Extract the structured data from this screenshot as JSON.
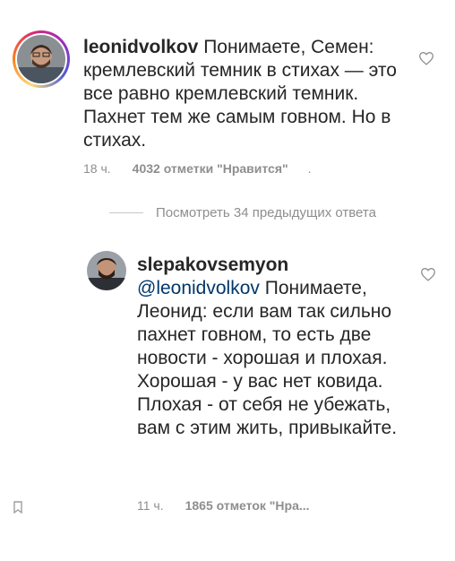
{
  "comment": {
    "username": "leonidvolkov",
    "text": " Понимаете, Семен: кремлевский темник в стихах — это все равно кремлевский темник. Пахнет тем же самым говном. Но в стихах.",
    "time": "18 ч.",
    "likes": "4032 отметки \"Нравится\"",
    "more": "."
  },
  "view_replies": "Посмотреть 34 предыдущих ответа",
  "reply": {
    "username": "slepakovsemyon",
    "mention": "@leonidvolkov",
    "text": " Понимаете, Леонид: если вам так сильно пахнет говном, то есть две новости - хорошая и плохая. Хорошая - у вас нет ковида. Плохая - от себя не убежать, вам с этим жить, привыкайте.",
    "time": "11 ч.",
    "likes": "1865 отметок \"Нра..."
  },
  "icons": {
    "heart": "heart-outline-icon",
    "bookmark": "bookmark-icon"
  },
  "colors": {
    "text": "#262626",
    "secondary": "#8e8e8e",
    "mention": "#00376b"
  }
}
